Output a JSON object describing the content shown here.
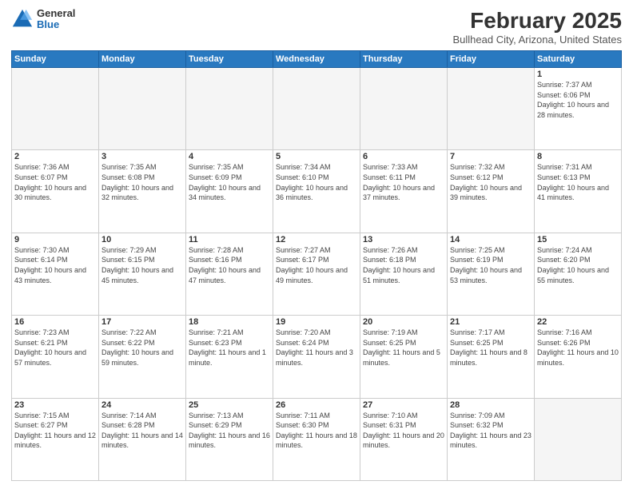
{
  "header": {
    "logo_general": "General",
    "logo_blue": "Blue",
    "main_title": "February 2025",
    "subtitle": "Bullhead City, Arizona, United States"
  },
  "days_of_week": [
    "Sunday",
    "Monday",
    "Tuesday",
    "Wednesday",
    "Thursday",
    "Friday",
    "Saturday"
  ],
  "weeks": [
    [
      {
        "day": "",
        "info": ""
      },
      {
        "day": "",
        "info": ""
      },
      {
        "day": "",
        "info": ""
      },
      {
        "day": "",
        "info": ""
      },
      {
        "day": "",
        "info": ""
      },
      {
        "day": "",
        "info": ""
      },
      {
        "day": "1",
        "info": "Sunrise: 7:37 AM\nSunset: 6:06 PM\nDaylight: 10 hours and 28 minutes."
      }
    ],
    [
      {
        "day": "2",
        "info": "Sunrise: 7:36 AM\nSunset: 6:07 PM\nDaylight: 10 hours and 30 minutes."
      },
      {
        "day": "3",
        "info": "Sunrise: 7:35 AM\nSunset: 6:08 PM\nDaylight: 10 hours and 32 minutes."
      },
      {
        "day": "4",
        "info": "Sunrise: 7:35 AM\nSunset: 6:09 PM\nDaylight: 10 hours and 34 minutes."
      },
      {
        "day": "5",
        "info": "Sunrise: 7:34 AM\nSunset: 6:10 PM\nDaylight: 10 hours and 36 minutes."
      },
      {
        "day": "6",
        "info": "Sunrise: 7:33 AM\nSunset: 6:11 PM\nDaylight: 10 hours and 37 minutes."
      },
      {
        "day": "7",
        "info": "Sunrise: 7:32 AM\nSunset: 6:12 PM\nDaylight: 10 hours and 39 minutes."
      },
      {
        "day": "8",
        "info": "Sunrise: 7:31 AM\nSunset: 6:13 PM\nDaylight: 10 hours and 41 minutes."
      }
    ],
    [
      {
        "day": "9",
        "info": "Sunrise: 7:30 AM\nSunset: 6:14 PM\nDaylight: 10 hours and 43 minutes."
      },
      {
        "day": "10",
        "info": "Sunrise: 7:29 AM\nSunset: 6:15 PM\nDaylight: 10 hours and 45 minutes."
      },
      {
        "day": "11",
        "info": "Sunrise: 7:28 AM\nSunset: 6:16 PM\nDaylight: 10 hours and 47 minutes."
      },
      {
        "day": "12",
        "info": "Sunrise: 7:27 AM\nSunset: 6:17 PM\nDaylight: 10 hours and 49 minutes."
      },
      {
        "day": "13",
        "info": "Sunrise: 7:26 AM\nSunset: 6:18 PM\nDaylight: 10 hours and 51 minutes."
      },
      {
        "day": "14",
        "info": "Sunrise: 7:25 AM\nSunset: 6:19 PM\nDaylight: 10 hours and 53 minutes."
      },
      {
        "day": "15",
        "info": "Sunrise: 7:24 AM\nSunset: 6:20 PM\nDaylight: 10 hours and 55 minutes."
      }
    ],
    [
      {
        "day": "16",
        "info": "Sunrise: 7:23 AM\nSunset: 6:21 PM\nDaylight: 10 hours and 57 minutes."
      },
      {
        "day": "17",
        "info": "Sunrise: 7:22 AM\nSunset: 6:22 PM\nDaylight: 10 hours and 59 minutes."
      },
      {
        "day": "18",
        "info": "Sunrise: 7:21 AM\nSunset: 6:23 PM\nDaylight: 11 hours and 1 minute."
      },
      {
        "day": "19",
        "info": "Sunrise: 7:20 AM\nSunset: 6:24 PM\nDaylight: 11 hours and 3 minutes."
      },
      {
        "day": "20",
        "info": "Sunrise: 7:19 AM\nSunset: 6:25 PM\nDaylight: 11 hours and 5 minutes."
      },
      {
        "day": "21",
        "info": "Sunrise: 7:17 AM\nSunset: 6:25 PM\nDaylight: 11 hours and 8 minutes."
      },
      {
        "day": "22",
        "info": "Sunrise: 7:16 AM\nSunset: 6:26 PM\nDaylight: 11 hours and 10 minutes."
      }
    ],
    [
      {
        "day": "23",
        "info": "Sunrise: 7:15 AM\nSunset: 6:27 PM\nDaylight: 11 hours and 12 minutes."
      },
      {
        "day": "24",
        "info": "Sunrise: 7:14 AM\nSunset: 6:28 PM\nDaylight: 11 hours and 14 minutes."
      },
      {
        "day": "25",
        "info": "Sunrise: 7:13 AM\nSunset: 6:29 PM\nDaylight: 11 hours and 16 minutes."
      },
      {
        "day": "26",
        "info": "Sunrise: 7:11 AM\nSunset: 6:30 PM\nDaylight: 11 hours and 18 minutes."
      },
      {
        "day": "27",
        "info": "Sunrise: 7:10 AM\nSunset: 6:31 PM\nDaylight: 11 hours and 20 minutes."
      },
      {
        "day": "28",
        "info": "Sunrise: 7:09 AM\nSunset: 6:32 PM\nDaylight: 11 hours and 23 minutes."
      },
      {
        "day": "",
        "info": ""
      }
    ]
  ]
}
